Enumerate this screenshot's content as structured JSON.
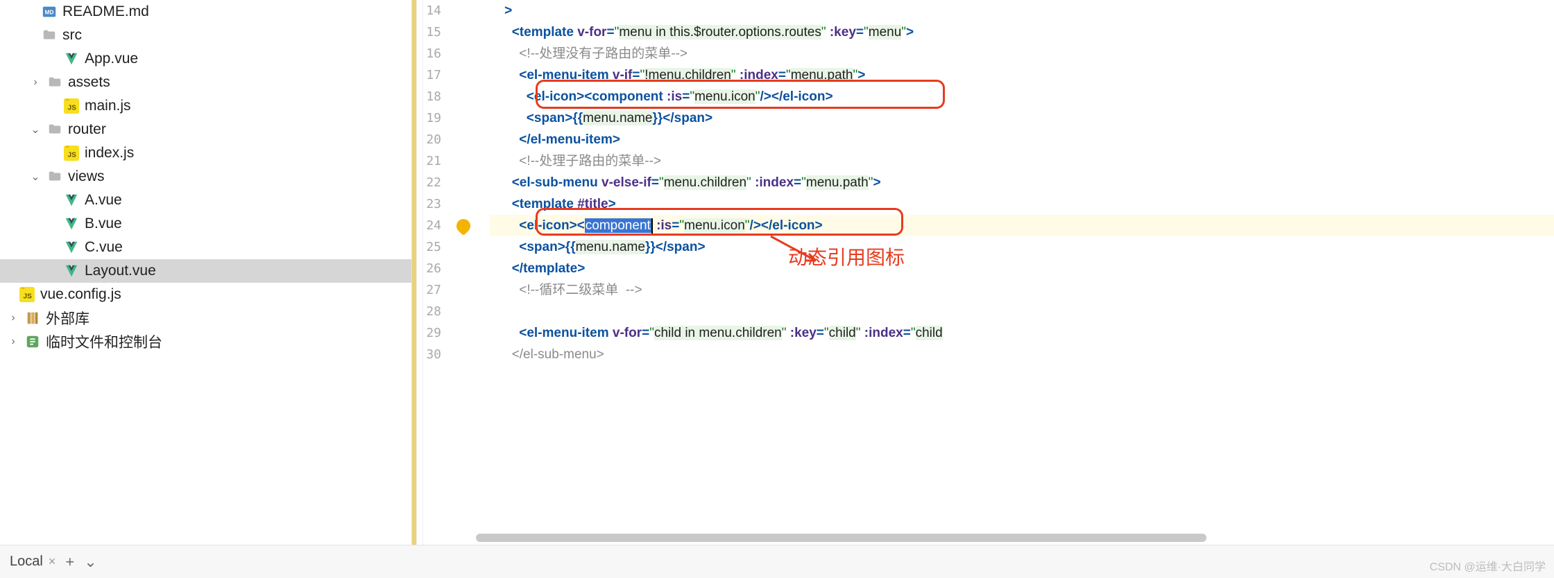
{
  "tree": {
    "items": [
      {
        "depth": 1,
        "chev": "",
        "icon": "md",
        "label": "README.md",
        "selected": false
      },
      {
        "depth": 1,
        "chev": "",
        "icon": "folder",
        "label": "src",
        "selected": false
      },
      {
        "depth": 2,
        "chev": "",
        "icon": "vue",
        "label": "App.vue",
        "selected": false
      },
      {
        "depth": 1,
        "chev": ">",
        "icon": "folder",
        "label": "assets",
        "selected": false
      },
      {
        "depth": 2,
        "chev": "",
        "icon": "js",
        "label": "main.js",
        "selected": false
      },
      {
        "depth": 1,
        "chev": "v",
        "icon": "folder",
        "label": "router",
        "selected": false
      },
      {
        "depth": 2,
        "chev": "",
        "icon": "js",
        "label": "index.js",
        "selected": false
      },
      {
        "depth": 1,
        "chev": "v",
        "icon": "folder",
        "label": "views",
        "selected": false
      },
      {
        "depth": 2,
        "chev": "",
        "icon": "vue",
        "label": "A.vue",
        "selected": false
      },
      {
        "depth": 2,
        "chev": "",
        "icon": "vue",
        "label": "B.vue",
        "selected": false
      },
      {
        "depth": 2,
        "chev": "",
        "icon": "vue",
        "label": "C.vue",
        "selected": false
      },
      {
        "depth": 2,
        "chev": "",
        "icon": "vue",
        "label": "Layout.vue",
        "selected": true
      },
      {
        "depth": 0,
        "chev": "",
        "icon": "js",
        "label": "vue.config.js",
        "selected": false
      },
      {
        "depth": 0,
        "chev": ">",
        "icon": "lib",
        "label": "外部库",
        "selected": false
      },
      {
        "depth": 0,
        "chev": ">",
        "icon": "scratch",
        "label": "临时文件和控制台",
        "selected": false
      }
    ]
  },
  "gutter": {
    "start": 14,
    "end": 30,
    "bulb_at": 24
  },
  "code_lines": [
    {
      "n": 14,
      "segs": [
        [
          "txt",
          "    "
        ],
        [
          "pun",
          ">"
        ]
      ]
    },
    {
      "n": 15,
      "segs": [
        [
          "txt",
          "      "
        ],
        [
          "pun",
          "<"
        ],
        [
          "tag",
          "template"
        ],
        [
          "txt",
          " "
        ],
        [
          "dir",
          "v-for"
        ],
        [
          "pun",
          "="
        ],
        [
          "str",
          "\""
        ],
        [
          "strbg",
          "menu in this.$router.options.routes"
        ],
        [
          "str",
          "\""
        ],
        [
          "txt",
          " "
        ],
        [
          "dir",
          ":key"
        ],
        [
          "pun",
          "="
        ],
        [
          "str",
          "\""
        ],
        [
          "strbg",
          "menu"
        ],
        [
          "str",
          "\""
        ],
        [
          "pun",
          ">"
        ]
      ]
    },
    {
      "n": 16,
      "segs": [
        [
          "txt",
          "        "
        ],
        [
          "cmt",
          "<!--处理没有子路由的菜单-->"
        ]
      ]
    },
    {
      "n": 17,
      "segs": [
        [
          "txt",
          "        "
        ],
        [
          "pun",
          "<"
        ],
        [
          "tag",
          "el-menu-item"
        ],
        [
          "txt",
          " "
        ],
        [
          "dir",
          "v-if"
        ],
        [
          "pun",
          "="
        ],
        [
          "str",
          "\""
        ],
        [
          "strbg",
          "!menu.children"
        ],
        [
          "str",
          "\""
        ],
        [
          "txt",
          " "
        ],
        [
          "dir",
          ":index"
        ],
        [
          "pun",
          "="
        ],
        [
          "str",
          "\""
        ],
        [
          "strbg",
          "menu.path"
        ],
        [
          "str",
          "\""
        ],
        [
          "pun",
          ">"
        ]
      ]
    },
    {
      "n": 18,
      "segs": [
        [
          "txt",
          "          "
        ],
        [
          "pun",
          "<"
        ],
        [
          "tag",
          "el-icon"
        ],
        [
          "pun",
          "><"
        ],
        [
          "tag",
          "component"
        ],
        [
          "txt",
          " "
        ],
        [
          "dir",
          ":is"
        ],
        [
          "pun",
          "="
        ],
        [
          "str",
          "\""
        ],
        [
          "strbg",
          "menu.icon"
        ],
        [
          "str",
          "\""
        ],
        [
          "pun",
          "/></"
        ],
        [
          "tag",
          "el-icon"
        ],
        [
          "pun",
          ">"
        ]
      ]
    },
    {
      "n": 19,
      "segs": [
        [
          "txt",
          "          "
        ],
        [
          "pun",
          "<"
        ],
        [
          "tag",
          "span"
        ],
        [
          "pun",
          ">{{"
        ],
        [
          "strbg",
          "menu.name"
        ],
        [
          "pun",
          "}}</"
        ],
        [
          "tag",
          "span"
        ],
        [
          "pun",
          ">"
        ]
      ]
    },
    {
      "n": 20,
      "segs": [
        [
          "txt",
          "        "
        ],
        [
          "pun",
          "</"
        ],
        [
          "tag",
          "el-menu-item"
        ],
        [
          "pun",
          ">"
        ]
      ]
    },
    {
      "n": 21,
      "segs": [
        [
          "txt",
          "        "
        ],
        [
          "cmt",
          "<!--处理子路由的菜单-->"
        ]
      ]
    },
    {
      "n": 22,
      "segs": [
        [
          "txt",
          "      "
        ],
        [
          "pun",
          "<"
        ],
        [
          "tag",
          "el-sub-menu"
        ],
        [
          "txt",
          " "
        ],
        [
          "dir",
          "v-else-if"
        ],
        [
          "pun",
          "="
        ],
        [
          "str",
          "\""
        ],
        [
          "strbg",
          "menu.children"
        ],
        [
          "str",
          "\""
        ],
        [
          "txt",
          " "
        ],
        [
          "dir",
          ":index"
        ],
        [
          "pun",
          "="
        ],
        [
          "str",
          "\""
        ],
        [
          "strbg",
          "menu.path"
        ],
        [
          "str",
          "\""
        ],
        [
          "pun",
          ">"
        ]
      ]
    },
    {
      "n": 23,
      "segs": [
        [
          "txt",
          "      "
        ],
        [
          "pun",
          "<"
        ],
        [
          "tag",
          "template"
        ],
        [
          "txt",
          " "
        ],
        [
          "dir",
          "#title"
        ],
        [
          "pun",
          ">"
        ]
      ]
    },
    {
      "n": 24,
      "hl": true,
      "segs": [
        [
          "txt",
          "        "
        ],
        [
          "pun",
          "<"
        ],
        [
          "tag",
          "el-icon"
        ],
        [
          "pun",
          "><"
        ],
        [
          "sel",
          "component"
        ],
        [
          "caret",
          ""
        ],
        [
          "txt",
          " "
        ],
        [
          "dir",
          ":is"
        ],
        [
          "pun",
          "="
        ],
        [
          "str",
          "\""
        ],
        [
          "strbg",
          "menu.icon"
        ],
        [
          "str",
          "\""
        ],
        [
          "pun",
          "/></"
        ],
        [
          "tag",
          "el-icon"
        ],
        [
          "pun",
          ">"
        ]
      ]
    },
    {
      "n": 25,
      "segs": [
        [
          "txt",
          "        "
        ],
        [
          "pun",
          "<"
        ],
        [
          "tag",
          "span"
        ],
        [
          "pun",
          ">{{"
        ],
        [
          "strbg",
          "menu.name"
        ],
        [
          "pun",
          "}}</"
        ],
        [
          "tag",
          "span"
        ],
        [
          "pun",
          ">"
        ]
      ]
    },
    {
      "n": 26,
      "segs": [
        [
          "txt",
          "      "
        ],
        [
          "pun",
          "</"
        ],
        [
          "tag",
          "template"
        ],
        [
          "pun",
          ">"
        ]
      ]
    },
    {
      "n": 27,
      "segs": [
        [
          "txt",
          "        "
        ],
        [
          "cmt",
          "<!--循环二级菜单  -->"
        ]
      ]
    },
    {
      "n": 28,
      "segs": [
        [
          "txt",
          ""
        ]
      ]
    },
    {
      "n": 29,
      "segs": [
        [
          "txt",
          "        "
        ],
        [
          "pun",
          "<"
        ],
        [
          "tag",
          "el-menu-item"
        ],
        [
          "txt",
          " "
        ],
        [
          "dir",
          "v-for"
        ],
        [
          "pun",
          "="
        ],
        [
          "str",
          "\""
        ],
        [
          "strbg",
          "child in menu.children"
        ],
        [
          "str",
          "\""
        ],
        [
          "txt",
          " "
        ],
        [
          "dir",
          ":key"
        ],
        [
          "pun",
          "="
        ],
        [
          "str",
          "\""
        ],
        [
          "strbg",
          "child"
        ],
        [
          "str",
          "\""
        ],
        [
          "txt",
          " "
        ],
        [
          "dir",
          ":index"
        ],
        [
          "pun",
          "="
        ],
        [
          "str",
          "\""
        ],
        [
          "strbg",
          "child"
        ]
      ]
    },
    {
      "n": 30,
      "segs": [
        [
          "txt",
          "      "
        ],
        [
          "cmt",
          "</el-sub-menu>"
        ]
      ]
    }
  ],
  "annotation": {
    "text": "动态引用图标"
  },
  "bottom": {
    "tab": "Local",
    "plus": "+",
    "down": "⌄"
  },
  "watermark": "CSDN @运维·大白同学"
}
